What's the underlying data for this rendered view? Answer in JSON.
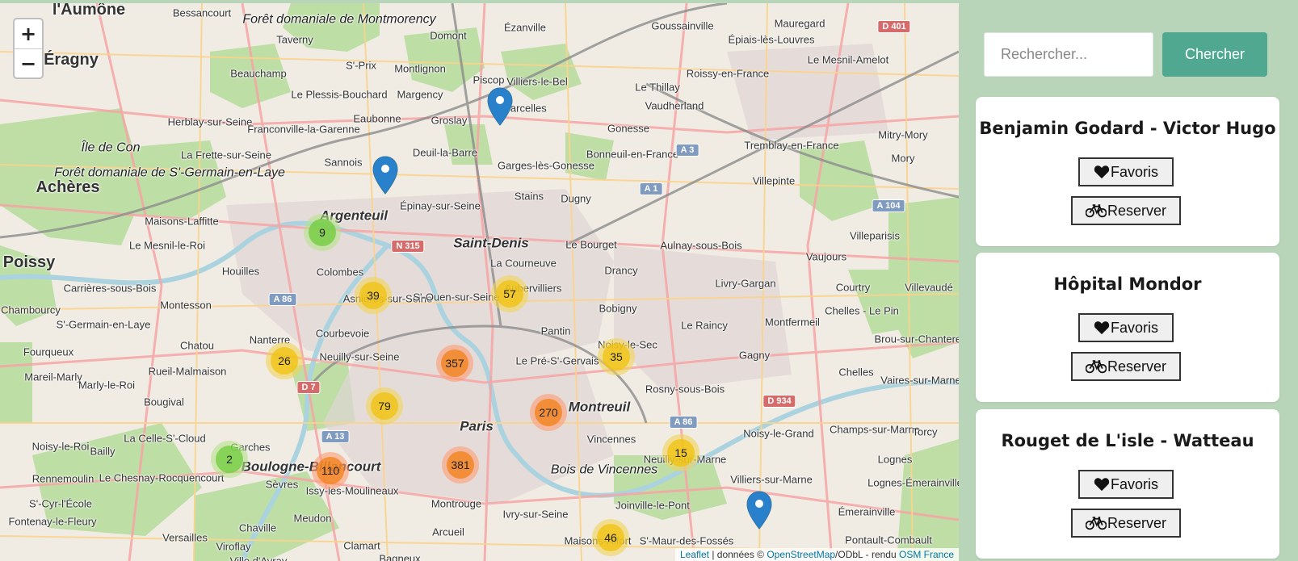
{
  "map": {
    "zoom_in": "+",
    "zoom_out": "−",
    "attribution": {
      "leaflet": "Leaflet",
      "sep1": " | données © ",
      "osm": "OpenStreetMap",
      "sep2": "/ODbL - rendu ",
      "osmfr": "OSM France"
    },
    "places": [
      "l'Aumône",
      "Bessancourt",
      "Forêt domaniale de Montmorency",
      "Domont",
      "Ézanville",
      "Goussainville",
      "Épiais-lès-Louvres",
      "Le Mesnil-Amelot",
      "Mauregard",
      "Éragny",
      "Taverny",
      "Beauchamp",
      "S'-Prix",
      "Montlignon",
      "Le Plessis-Bouchard",
      "Margency",
      "Piscop",
      "Villiers-le-Bel",
      "Le Thillay",
      "Roissy-en-France",
      "Herblay-sur-Seine",
      "Franconville-la-Garenne",
      "Eaubonne",
      "Groslay",
      "Sarcelles",
      "Vaudherland",
      "Gonesse",
      "Tremblay-en-France",
      "Mitry-Mory",
      "Île de Con",
      "Sannois",
      "Deuil-la-Barre",
      "Garges-lès-Gonesse",
      "Bonneuil-en-France",
      "Mory",
      "Achères",
      "Forêt domaniale de S'-Germain-en-Laye",
      "La Frette-sur-Seine",
      "Épinay-sur-Seine",
      "Stains",
      "Dugny",
      "Villepinte",
      "Maisons-Laffitte",
      "Le Mesnil-le-Roi",
      "Argenteuil",
      "Saint-Denis",
      "Le Bourget",
      "Aulnay-sous-Bois",
      "Villeparisis",
      "Poissy",
      "Houilles",
      "Colombes",
      "La Courneuve",
      "Drancy",
      "Vaujours",
      "Carrières-sous-Bois",
      "Montesson",
      "Asnières-sur-Seine",
      "S'-Ouen-sur-Seine",
      "Aubervilliers",
      "Livry-Gargan",
      "Courtry",
      "Villevaudé",
      "Chambourcy",
      "S'-Germain-en-Laye",
      "Bobigny",
      "Chelles - Le Pin",
      "Courbevoie",
      "Nanterre",
      "Pantin",
      "Le Raincy",
      "Montfermeil",
      "Brou-sur-Chantereine",
      "Fourqueux",
      "Chatou",
      "Neuilly-sur-Seine",
      "Le Pré-S'-Gervais",
      "Noisy-le-Sec",
      "Gagny",
      "Chelles",
      "Vaires-sur-Marne",
      "Rueil-Malmaison",
      "Mareil-Marly",
      "Marly-le-Roi",
      "Montreuil",
      "Rosny-sous-Bois",
      "Bougival",
      "Paris",
      "Champs-sur-Marne",
      "Noisy-le-Grand",
      "Torcy",
      "La Celle-S'-Cloud",
      "Garches",
      "Boulogne-Billancourt",
      "Vincennes",
      "Bois de Vincennes",
      "Neuilly-sur-Marne",
      "Lognes",
      "Noisy-le-Roi",
      "Bailly",
      "Le Chesnay-Rocquencourt",
      "Rennemoulin",
      "Sèvres",
      "Issy-les-Moulineaux",
      "Villiers-sur-Marne",
      "Lognes-Émerainville",
      "S'-Cyr-l'École",
      "Fontenay-le-Fleury",
      "Montrouge",
      "Ivry-sur-Seine",
      "Joinville-le-Pont",
      "Émerainville",
      "Meudon",
      "Chaville",
      "Versailles",
      "Viroflay",
      "Clamart",
      "Arcueil",
      "Maisons-Alfort",
      "S'-Maur-des-Fossés",
      "Pontault-Combault",
      "Bagneux",
      "Ville d'Avray"
    ],
    "road_shields": [
      "D 401",
      "A 3",
      "A 1",
      "A 104",
      "N 315",
      "A 86",
      "D 7",
      "A 13",
      "D 934",
      "A 86"
    ],
    "clusters": [
      {
        "count": "9",
        "color": "green"
      },
      {
        "count": "39",
        "color": "yellow"
      },
      {
        "count": "57",
        "color": "yellow"
      },
      {
        "count": "26",
        "color": "yellow"
      },
      {
        "count": "357",
        "color": "orange"
      },
      {
        "count": "35",
        "color": "yellow"
      },
      {
        "count": "79",
        "color": "yellow"
      },
      {
        "count": "270",
        "color": "orange"
      },
      {
        "count": "15",
        "color": "yellow"
      },
      {
        "count": "2",
        "color": "green"
      },
      {
        "count": "110",
        "color": "orange"
      },
      {
        "count": "381",
        "color": "orange"
      },
      {
        "count": "46",
        "color": "yellow"
      }
    ]
  },
  "search": {
    "placeholder": "Rechercher...",
    "button": "Chercher"
  },
  "stations": [
    {
      "name": "Benjamin Godard - Victor Hugo",
      "fav_label": "Favoris",
      "reserve_label": "Reserver"
    },
    {
      "name": "Hôpital Mondor",
      "fav_label": "Favoris",
      "reserve_label": "Reserver"
    },
    {
      "name": "Rouget de L'isle - Watteau",
      "fav_label": "Favoris",
      "reserve_label": "Reserver"
    }
  ],
  "colors": {
    "sidebar_bg": "#b9d5b9",
    "search_button": "#4fa88f",
    "marker_blue": "#2a81cb",
    "cluster_green": "#6ecc39",
    "cluster_yellow": "#f0c20c",
    "cluster_orange": "#f18017"
  }
}
